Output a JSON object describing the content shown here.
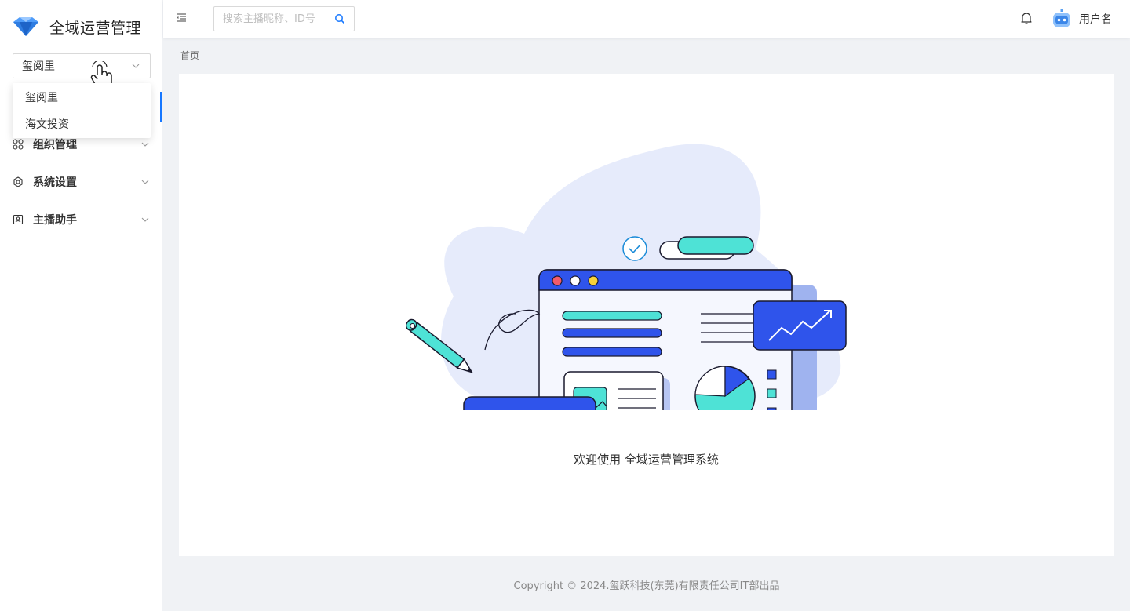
{
  "app": {
    "title": "全域运营管理"
  },
  "org_select": {
    "value": "玺阅里",
    "options": [
      "玺阅里",
      "海文投资"
    ]
  },
  "menu": [
    {
      "label": "组织管理",
      "icon": "apps-icon"
    },
    {
      "label": "系统设置",
      "icon": "settings-icon"
    },
    {
      "label": "主播助手",
      "icon": "assistant-icon"
    }
  ],
  "header": {
    "search_placeholder": "搜索主播昵称、ID号",
    "user_name": "用户名"
  },
  "breadcrumb": {
    "home": "首页"
  },
  "main": {
    "welcome": "欢迎使用 全域运营管理系统"
  },
  "footer": {
    "copyright": "Copyright © 2024.玺跃科技(东莞)有限责任公司IT部出品"
  },
  "colors": {
    "accent": "#1677ff",
    "illustration_blue": "#2f54eb",
    "illustration_teal": "#4ee2d6"
  }
}
